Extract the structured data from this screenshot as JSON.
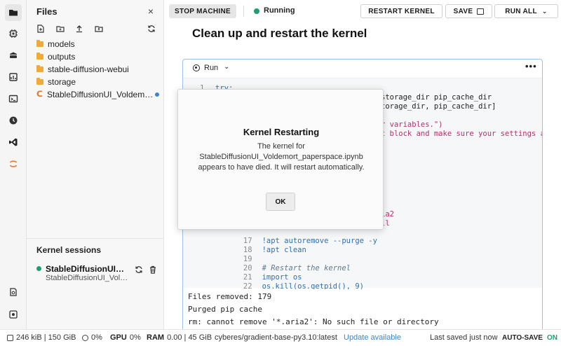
{
  "activity_bar": {
    "icons": [
      "folder-icon",
      "chip-icon",
      "stack-icon",
      "metrics-icon",
      "terminal-icon",
      "clock-icon",
      "vscode-icon",
      "jupyter-icon",
      "help-icon",
      "settings-icon"
    ]
  },
  "files_panel": {
    "title": "Files",
    "close_label": "×",
    "items": [
      {
        "name": "models",
        "type": "folder"
      },
      {
        "name": "outputs",
        "type": "folder"
      },
      {
        "name": "stable-diffusion-webui",
        "type": "folder"
      },
      {
        "name": "storage",
        "type": "folder"
      },
      {
        "name": "StableDiffusionUI_Voldemort_paperspace.ipynb",
        "type": "notebook"
      }
    ]
  },
  "kernel_sessions": {
    "title": "Kernel sessions",
    "session_name": "StableDiffusionUI_Voldemort_paperspace.ipynb",
    "session_sub": "StableDiffusionUI_Voldemort_paperspace.ipynb"
  },
  "toolbar": {
    "stop_machine": "STOP MACHINE",
    "status": "Running",
    "restart_kernel": "RESTART KERNEL",
    "save": "SAVE",
    "run_all": "RUN ALL"
  },
  "main": {
    "heading": "Clean up and restart the kernel",
    "cell": {
      "run_label": "Run",
      "more_label": "•••",
      "frag_1_prefix": "1",
      "frag_1": "try:",
      "frag_2": "storage_dir pip_cache_dir",
      "frag_3": "torage_dir, pip_cache_dir]",
      "frag_4": "r variables.\")",
      "frag_5": "t block and make sure your settings a",
      "frag_6": "ia2",
      "frag_7": "ll",
      "lines": [
        {
          "n": "17",
          "code": "!apt autoremove --purge -y"
        },
        {
          "n": "18",
          "code": "!apt clean"
        },
        {
          "n": "19",
          "code": ""
        },
        {
          "n": "20",
          "code": "# Restart the kernel"
        },
        {
          "n": "21",
          "code": "import os"
        },
        {
          "n": "22",
          "code": "os.kill(os.getpid(), 9)"
        }
      ],
      "output": [
        "Files removed: 179",
        "Purged pip cache",
        "rm: cannot remove '*.aria2': No such file or directory"
      ]
    }
  },
  "modal": {
    "title": "Kernel Restarting",
    "line1": "The kernel for",
    "line2": "StableDiffusionUI_Voldemort_paperspace.ipynb",
    "line3": "appears to have died. It will restart automatically.",
    "ok": "OK"
  },
  "statusbar": {
    "storage": "246 kiB | 150 GiB",
    "cpu": "0%",
    "gpu_label": "GPU",
    "gpu": "0%",
    "ram_label": "RAM",
    "ram": "0.00 | 45 GiB",
    "image": "cyberes/gradient-base-py3.10:latest",
    "update": "Update available",
    "last_saved": "Last saved just now",
    "autosave_label": "AUTO-SAVE",
    "autosave_value": "ON"
  },
  "colors": {
    "accent_green": "#1f9d71",
    "link_blue": "#3b86c8",
    "folder_orange": "#f0a93b",
    "cell_border": "#9cc3e6"
  }
}
